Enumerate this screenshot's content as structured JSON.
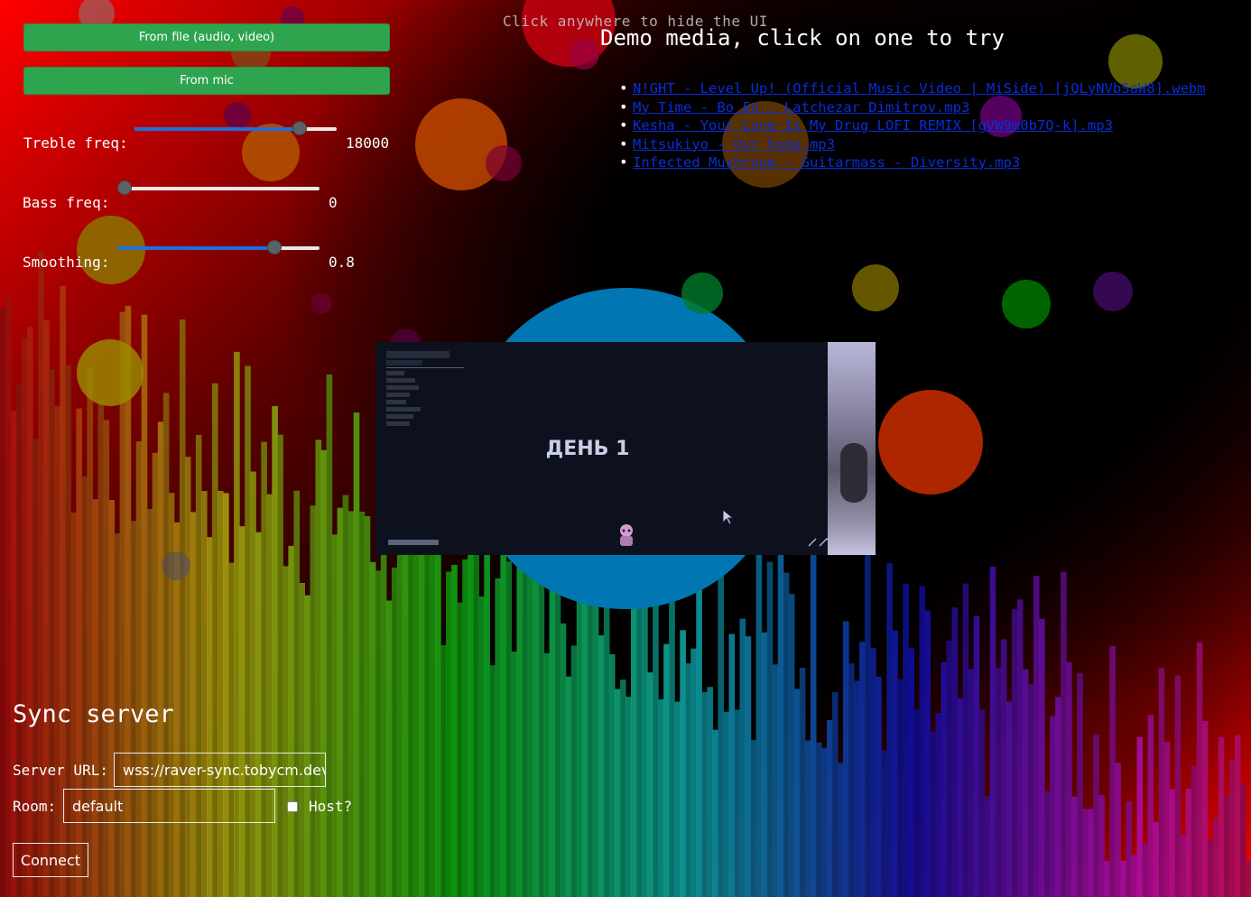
{
  "hint": "Click anywhere to hide the UI",
  "input": {
    "from_file": "From file (audio, video)",
    "from_mic": "From mic"
  },
  "controls": {
    "treble": {
      "label": "Treble freq:",
      "value": "18000",
      "fraction": 0.84
    },
    "bass": {
      "label": "Bass freq:",
      "value": "0",
      "fraction": 0.0
    },
    "smoothing": {
      "label": "Smoothing:",
      "value": "0.8",
      "fraction": 0.8
    }
  },
  "demo": {
    "title": "Demo media, click on one to try",
    "items": [
      "N!GHT - Level Up! (Official Music Video | MiSide) [jQLyNVbSaW8].webm",
      "My Time - Bo En - Latchezar Dimitrov.mp3",
      "Kesha - Your Love Is My Drug LOFI REMIX [gVW9m0b7Q-k].mp3",
      "Mitsukiyo - Our home.mp3",
      "Infected Mushroom - Guitarmass - Diversity.mp3"
    ]
  },
  "video": {
    "frame_title": "ДЕНЬ 1"
  },
  "sync": {
    "title": "Sync server",
    "server_url_label": "Server URL:",
    "server_url_value": "wss://raver-sync.tobycm.dev",
    "room_label": "Room:",
    "room_value": "default",
    "host_label": "Host?",
    "host_checked": false,
    "connect_label": "Connect"
  },
  "colors": {
    "button_green": "#2ea44f",
    "link_blue": "#0a2dd8",
    "slider_blue": "#1e6fd9",
    "center_circle": "#0077b3"
  }
}
